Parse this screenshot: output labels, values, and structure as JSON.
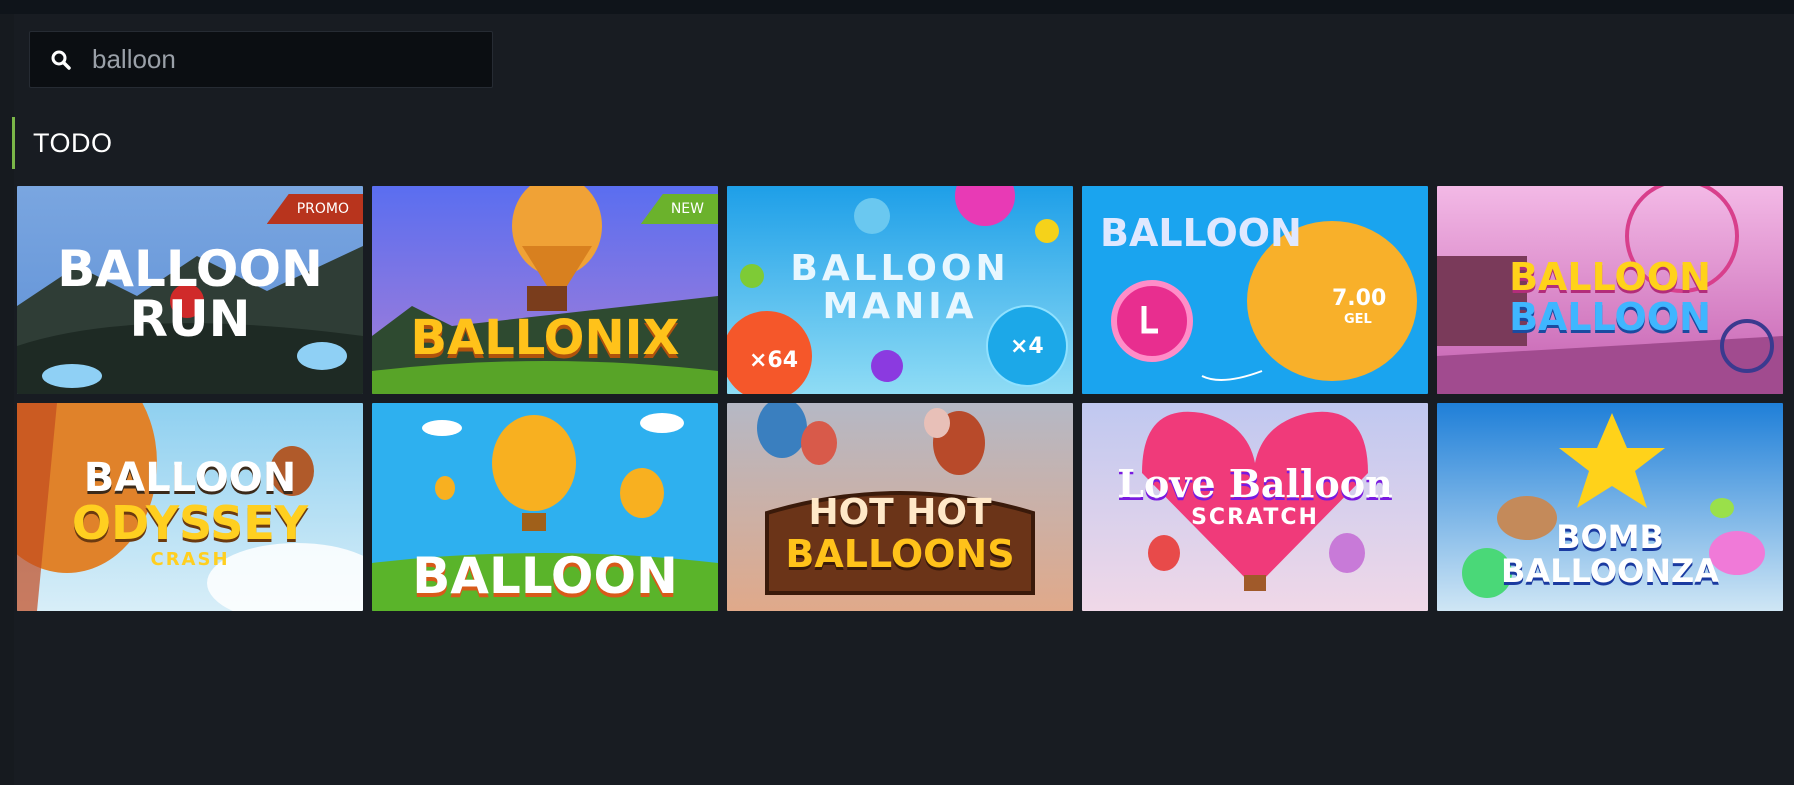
{
  "search": {
    "value": "balloon",
    "placeholder": ""
  },
  "section": {
    "title": "TODO"
  },
  "games": [
    {
      "logo_line1": "BALLOON",
      "logo_line2": "RUN",
      "badge": "PROMO",
      "badge_type": "promo",
      "small": "sp"
    },
    {
      "logo_line1": "BALLONIX",
      "badge": "NEW",
      "badge_type": "new"
    },
    {
      "logo_line1": "BALLOON",
      "logo_line2": "MANIA",
      "bubble1": "×64",
      "bubble2": "×4"
    },
    {
      "logo_line1": "BALLOON",
      "amount": "7.00",
      "currency": "GEL"
    },
    {
      "logo_line1": "BALLOON",
      "logo_line2": "BALLOON"
    },
    {
      "logo_line1": "BALLOON",
      "logo_line2": "ODYSSEY",
      "logo_line3": "CRASH"
    },
    {
      "logo_line1": "BALLOON"
    },
    {
      "logo_line1": "HOT HOT",
      "logo_line2": "BALLOONS"
    },
    {
      "logo_line1": "Love Balloon",
      "logo_line2": "SCRATCH"
    },
    {
      "logo_line1": "BOMB",
      "logo_line2": "BALLOONZA"
    }
  ],
  "colors": {
    "accent": "#7ab648",
    "promo": "#b8341d",
    "new": "#6bb22c"
  },
  "icons": {
    "search": "search-icon"
  }
}
